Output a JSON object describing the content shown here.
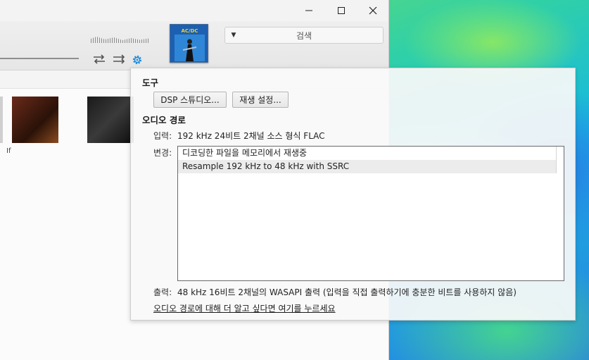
{
  "titlebar": {
    "minimize_icon": "minimize-icon",
    "maximize_icon": "maximize-icon",
    "close_icon": "close-icon"
  },
  "toolbar": {
    "repeat_icon": "repeat-icon",
    "shuffle_icon": "shuffle-icon",
    "settings_icon": "gear-icon",
    "accent": "#1e8fe0",
    "album_art_text": "AC/DC",
    "search": {
      "placeholder": "검색",
      "dropdown_icon": "caret-down-icon"
    }
  },
  "library": {
    "albums": [
      {
        "caption": "If"
      },
      {
        "caption": ""
      },
      {
        "caption": ""
      }
    ]
  },
  "panel": {
    "tools_title": "도구",
    "dsp_button": "DSP 스튜디오...",
    "playback_button": "재생 설정...",
    "audio_path_title": "오디오 경로",
    "input_label": "입력:",
    "input_value": "192 kHz 24비트 2채널 소스 형식 FLAC",
    "change_label": "변경:",
    "changes": [
      "디코딩한 파일을 메모리에서 재생중",
      "Resample 192 kHz to 48 kHz with SSRC"
    ],
    "output_label": "출력:",
    "output_value": "48 kHz 16비트 2채널의 WASAPI 출력 (입력을 직접 출력하기에 충분한 비트를 사용하지 않음)",
    "learn_more_link": "오디오 경로에 대해 더 알고 싶다면 여기를 누르세요"
  }
}
